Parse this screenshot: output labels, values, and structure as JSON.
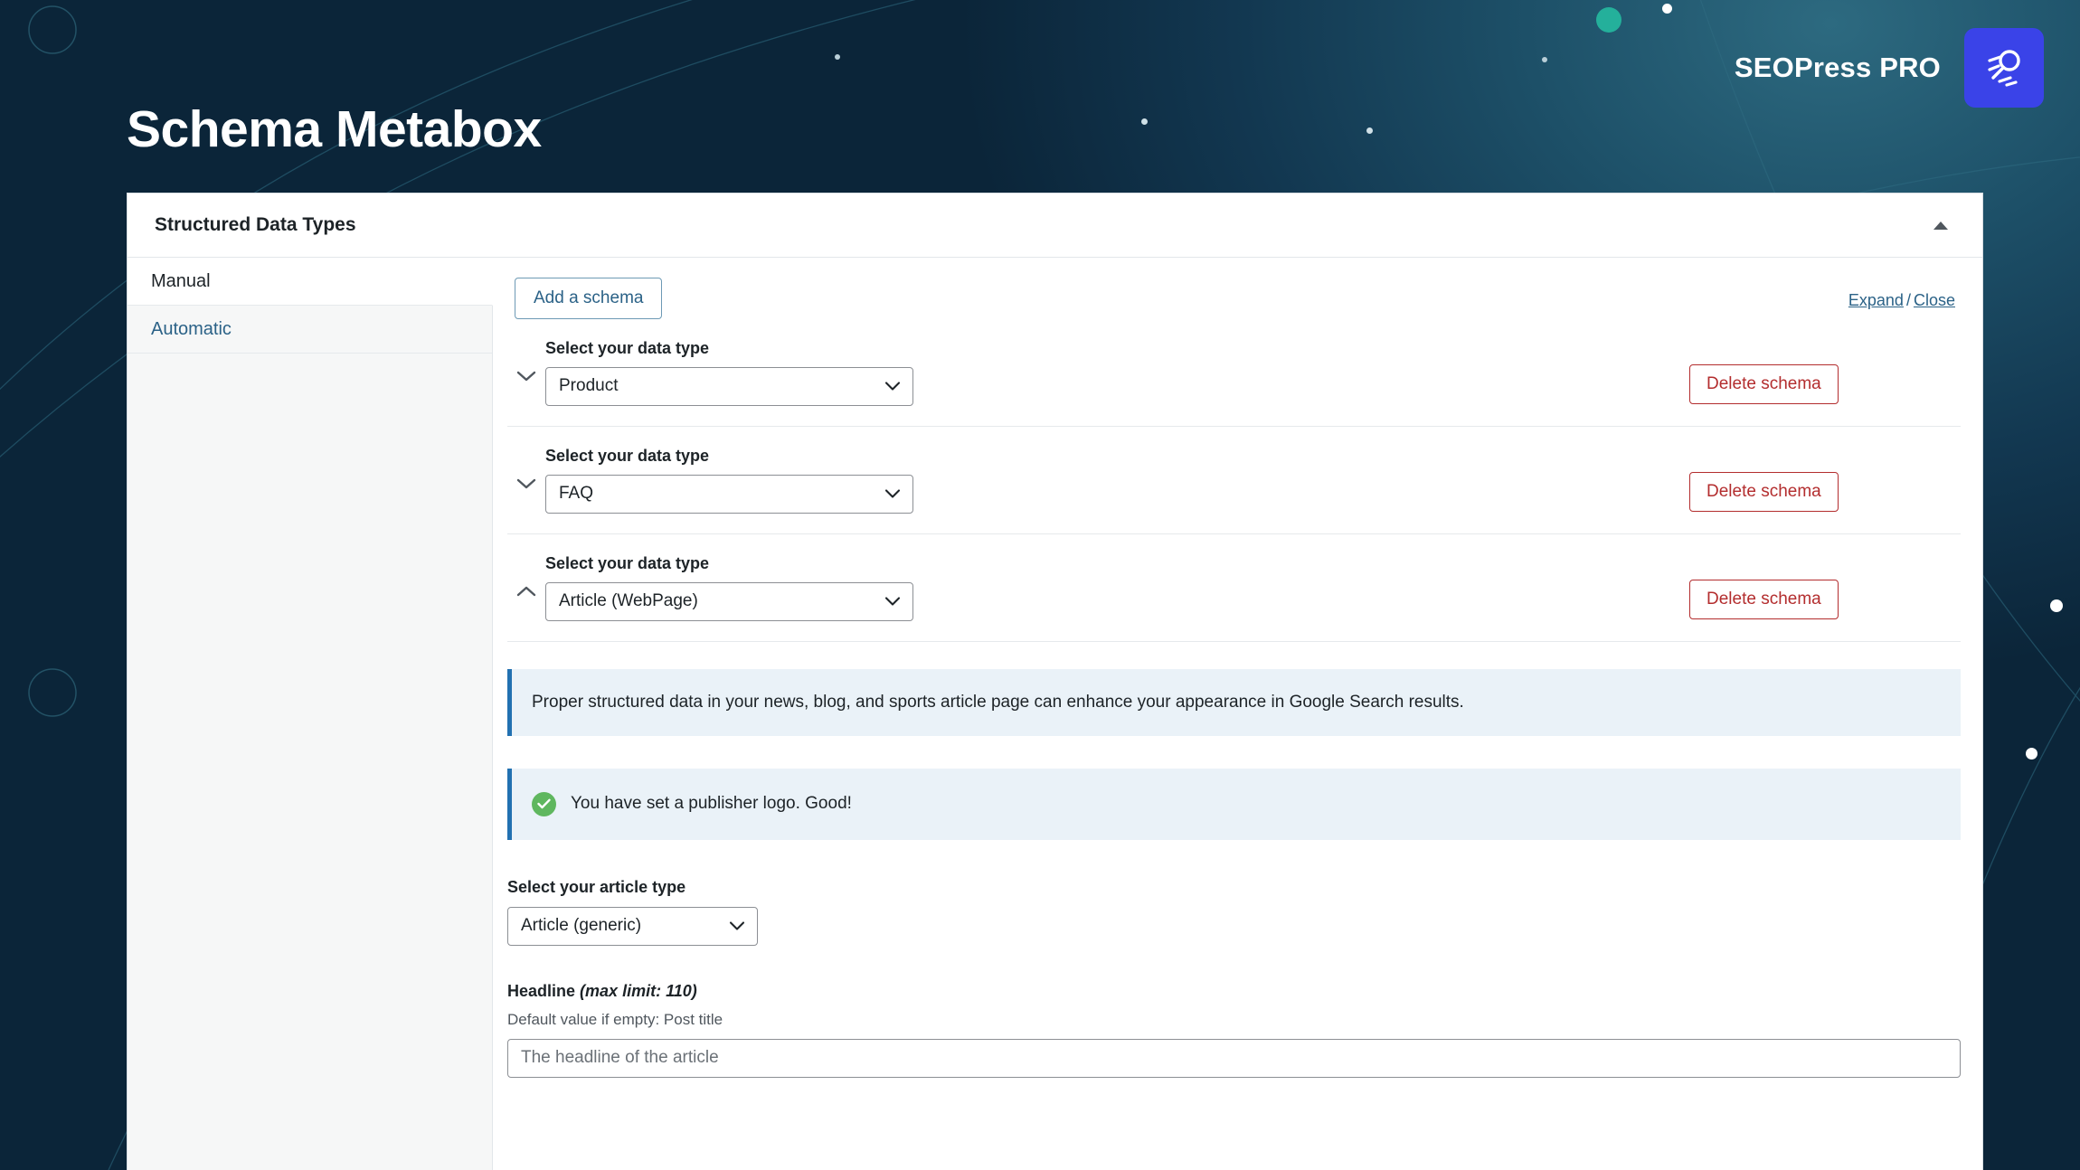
{
  "brand": {
    "name": "SEOPress PRO",
    "logo_icon": "magnifier-motion-icon",
    "logo_color": "#3a43e8"
  },
  "page": {
    "title": "Schema Metabox"
  },
  "panel": {
    "title": "Structured Data Types",
    "collapse_icon": "triangle-up-icon"
  },
  "sidebar": {
    "items": [
      {
        "label": "Manual",
        "active": true
      },
      {
        "label": "Automatic",
        "active": false
      }
    ]
  },
  "toolbar": {
    "add_schema_label": "Add a schema",
    "expand_label": "Expand",
    "separator": "/",
    "close_label": "Close"
  },
  "schemas": [
    {
      "label": "Select your data type",
      "value": "Product",
      "toggle_icon": "chevron-down-icon",
      "expanded": false,
      "delete_label": "Delete schema"
    },
    {
      "label": "Select your data type",
      "value": "FAQ",
      "toggle_icon": "chevron-down-icon",
      "expanded": false,
      "delete_label": "Delete schema"
    },
    {
      "label": "Select your data type",
      "value": "Article (WebPage)",
      "toggle_icon": "chevron-up-icon",
      "expanded": true,
      "delete_label": "Delete schema"
    }
  ],
  "notices": {
    "info": {
      "text": "Proper structured data in your news, blog, and sports article page can enhance your appearance in Google Search results.",
      "accent": "#2271b1"
    },
    "success": {
      "text": "You have set a publisher logo. Good!",
      "icon": "check-circle-icon",
      "icon_color": "#5fb75f",
      "accent": "#2271b1"
    }
  },
  "form": {
    "article_type": {
      "label": "Select your article type",
      "value": "Article (generic)"
    },
    "headline": {
      "label": "Headline",
      "label_suffix": "(max limit: 110)",
      "hint": "Default value if empty: Post title",
      "placeholder": "The headline of the article",
      "value": ""
    }
  },
  "colors": {
    "link": "#2b6287",
    "danger": "#b32d2e",
    "accent_teal": "#24b09b",
    "bg_dark": "#0a2236"
  }
}
